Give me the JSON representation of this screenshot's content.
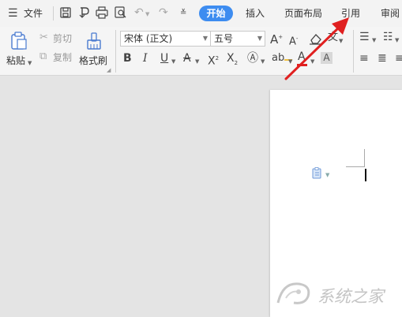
{
  "menu": {
    "file_label": "文件",
    "tabs": [
      {
        "label": "开始",
        "active": true
      },
      {
        "label": "插入"
      },
      {
        "label": "页面布局"
      },
      {
        "label": "引用"
      },
      {
        "label": "审阅"
      }
    ]
  },
  "clipboard": {
    "paste_label": "粘贴",
    "cut_label": "剪切",
    "copy_label": "复制",
    "format_painter_label": "格式刷"
  },
  "font": {
    "name_value": "宋体 (正文)",
    "size_value": "五号"
  },
  "format_buttons": {
    "bold": "B",
    "italic": "I",
    "underline": "U"
  },
  "watermark": {
    "text": "系统之家"
  },
  "colors": {
    "accent": "#3d8cf0",
    "arrow": "#e02020",
    "font_color_bar": "#e02020",
    "highlight": "#4a4acc"
  }
}
